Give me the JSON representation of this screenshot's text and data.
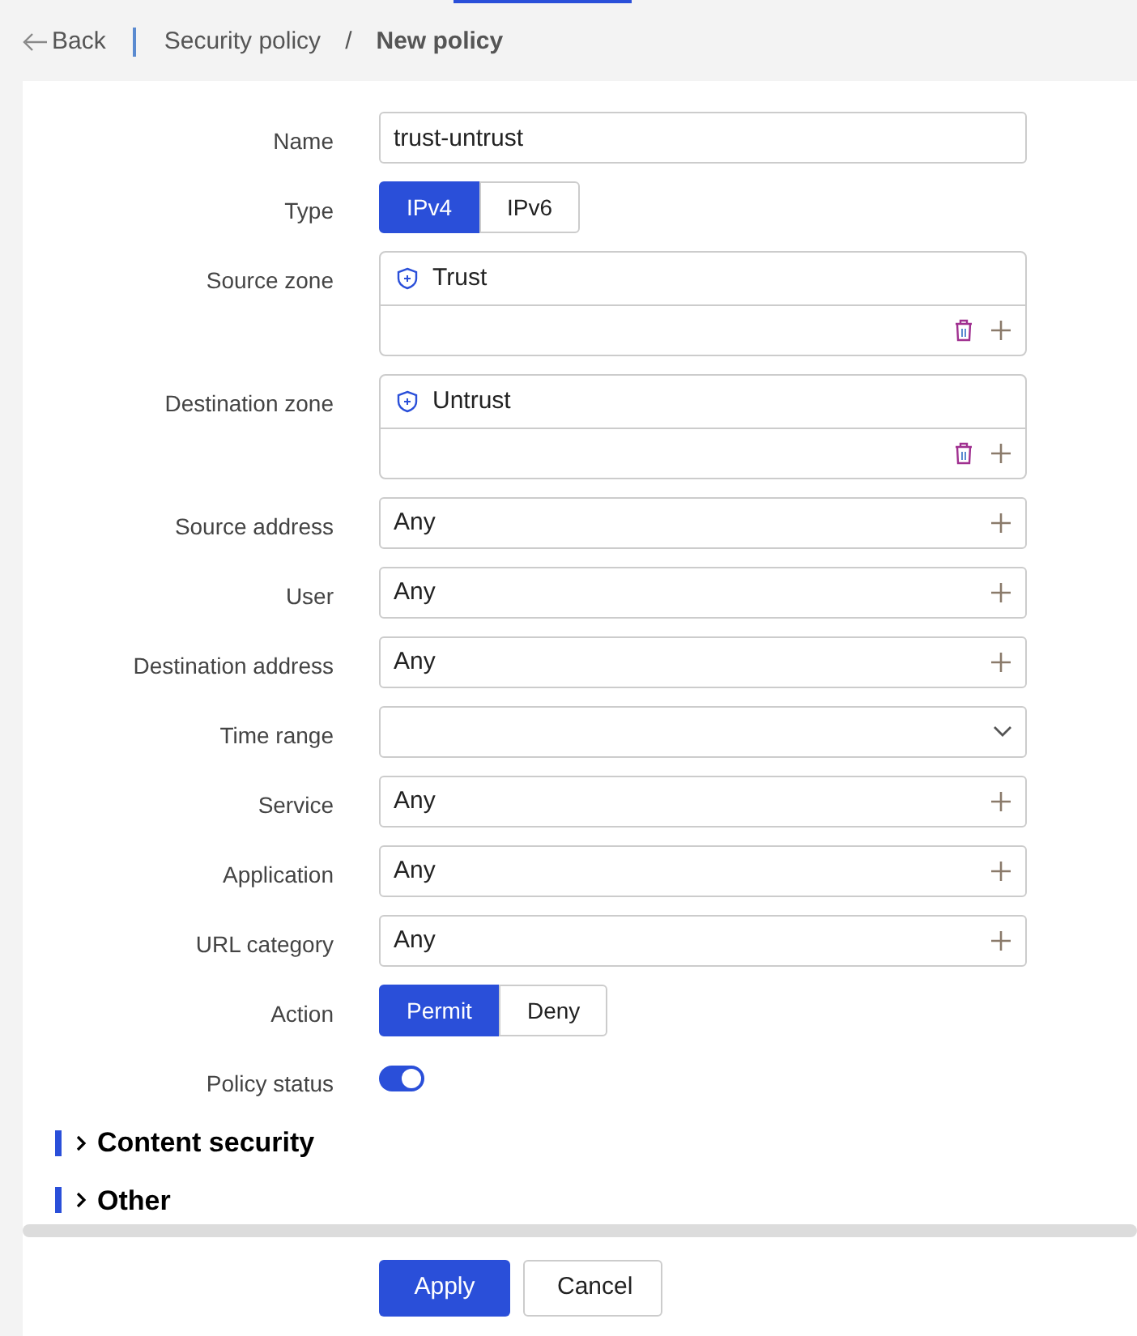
{
  "breadcrumb": {
    "back": "Back",
    "parent": "Security policy",
    "separator": "/",
    "current": "New policy"
  },
  "fields": [
    {
      "kind": "text",
      "label": "Name",
      "value": "trust-untrust"
    },
    {
      "kind": "segmented",
      "label": "Type",
      "options": [
        {
          "label": "IPv4",
          "selected": true
        },
        {
          "label": "IPv6",
          "selected": false
        }
      ]
    },
    {
      "kind": "zone",
      "label": "Source zone",
      "items": [
        "Trust"
      ]
    },
    {
      "kind": "zone",
      "label": "Destination zone",
      "items": [
        "Untrust"
      ]
    },
    {
      "kind": "picker",
      "label": "Source address",
      "value": "Any"
    },
    {
      "kind": "picker",
      "label": "User",
      "value": "Any"
    },
    {
      "kind": "picker",
      "label": "Destination address",
      "value": "Any"
    },
    {
      "kind": "select",
      "label": "Time range"
    },
    {
      "kind": "picker",
      "label": "Service",
      "value": "Any"
    },
    {
      "kind": "picker",
      "label": "Application",
      "value": "Any"
    },
    {
      "kind": "picker",
      "label": "URL category",
      "value": "Any"
    },
    {
      "kind": "segmented",
      "label": "Action",
      "options": [
        {
          "label": "Permit",
          "selected": true
        },
        {
          "label": "Deny",
          "selected": false
        }
      ]
    },
    {
      "kind": "toggle",
      "label": "Policy status",
      "on": true
    }
  ],
  "sections": [
    {
      "title": "Content security",
      "expanded": false
    },
    {
      "title": "Other",
      "expanded": false
    }
  ],
  "buttons": [
    {
      "label": "Apply",
      "kind": "primary"
    },
    {
      "label": "Cancel",
      "kind": "secondary"
    }
  ]
}
